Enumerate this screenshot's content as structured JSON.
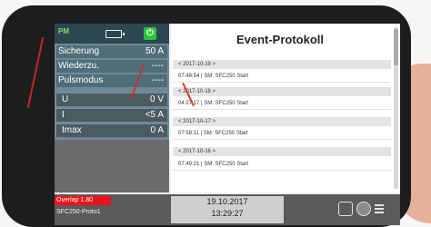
{
  "statusbar": {
    "mode": "PM",
    "battery_icon": "battery-icon",
    "power_icon": "power-icon",
    "power_glyph": "⏻",
    "power_color": "#2fc43a"
  },
  "settings": [
    {
      "label": "Sicherung",
      "value": "50 A"
    },
    {
      "label": "Wiederzu.",
      "value": "----"
    },
    {
      "label": "Pulsmodus",
      "value": "----"
    }
  ],
  "measurements": [
    {
      "label": "U",
      "value": "0 V"
    },
    {
      "label": "I",
      "value": "<5 A"
    },
    {
      "label": "Imax",
      "value": "0 A"
    }
  ],
  "event_log": {
    "title": "Event-Protokoll",
    "groups": [
      {
        "date": "< 2017-10-19 >",
        "entry": "07:48:54 | SM: SFC250 Start"
      },
      {
        "date": "< 2017-10-18 >",
        "entry": "04:27:17 | SM: SFC250 Start"
      },
      {
        "date": "< 2017-10-17 >",
        "entry": "07:58:11 | SM: SFC250 Start"
      },
      {
        "date": "< 2017-10-16 >",
        "entry": "07:49:21 | SM: SFC250 Start"
      }
    ]
  },
  "footer": {
    "alarm": "Overlap 1.80",
    "alarm_color": "#e8141a",
    "file": "SFC250-Proto1",
    "date": "19.10.2017",
    "time": "13:29:27",
    "icons": [
      "export-icon",
      "settings-icon",
      "menu-icon"
    ]
  }
}
